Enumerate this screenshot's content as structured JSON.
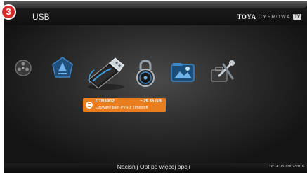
{
  "step_badge": "3",
  "header": {
    "title": "USB",
    "brand": {
      "toya": "TOYA",
      "cyfrowa": "CYFROWA",
      "tv": "TV"
    }
  },
  "menu": {
    "items": [
      {
        "icon": "media-reel-icon",
        "focused": false
      },
      {
        "icon": "recordings-folder-icon",
        "focused": false
      },
      {
        "icon": "usb-drive-icon",
        "focused": true
      },
      {
        "icon": "security-lock-icon",
        "focused": false
      },
      {
        "icon": "image-folder-icon",
        "focused": false
      },
      {
        "icon": "tools-icon",
        "focused": false
      }
    ]
  },
  "device": {
    "name": "DTR30G2",
    "size": "~ 29.35 GB",
    "usage": "Używany jako PVR z Timeshift"
  },
  "footer": {
    "hint": "Naciśnij Opt po więcej opcji",
    "clock": "16:14:03 13/07/2016"
  },
  "colors": {
    "accent": "#ea7d1d",
    "badge": "#d62828",
    "icon_blue": "#2a7fc4"
  }
}
